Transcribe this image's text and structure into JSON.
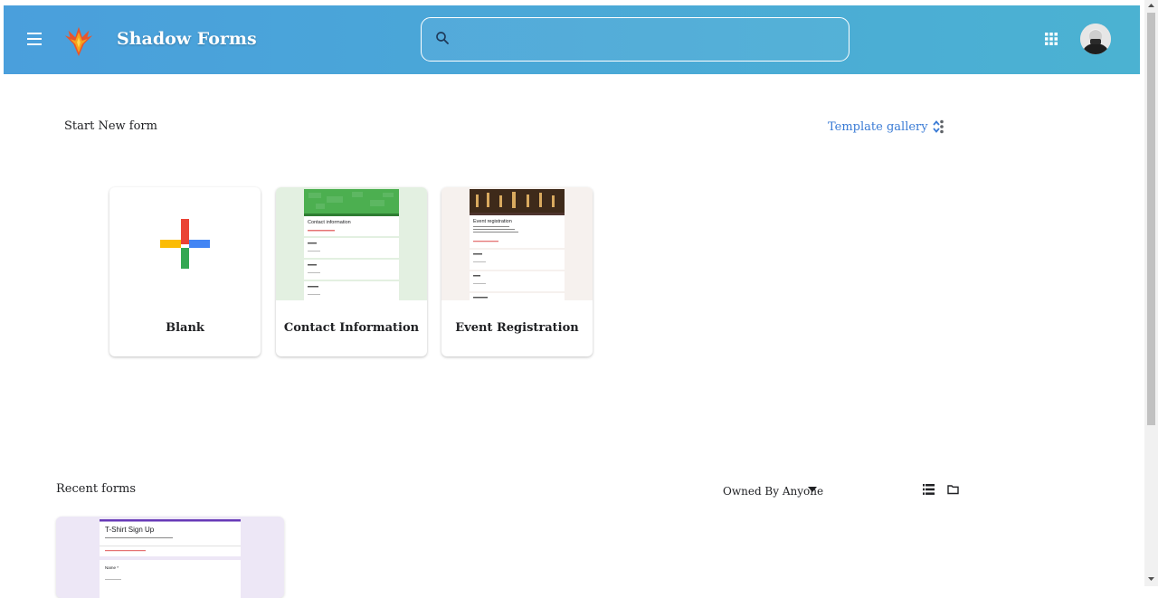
{
  "header": {
    "app_title": "Shadow Forms",
    "search_placeholder": ""
  },
  "start": {
    "title": "Start New form",
    "template_gallery_label": "Template gallery",
    "templates": [
      {
        "label": "Blank"
      },
      {
        "label": "Contact Information",
        "preview_title": "Contact information"
      },
      {
        "label": "Event Registration",
        "preview_title": "Event registration"
      }
    ]
  },
  "recent": {
    "title": "Recent forms",
    "owner_filter": "Owned By Anyone",
    "forms": [
      {
        "preview_title": "T-Shirt Sign Up",
        "preview_field": "Name *"
      }
    ]
  },
  "colors": {
    "header_start": "#4a9fdc",
    "header_end": "#4bb2d2",
    "link": "#3a7bd5",
    "plus_red": "#ea4335",
    "plus_blue": "#4285f4",
    "plus_green": "#34a853",
    "plus_yellow": "#fbbc05"
  }
}
